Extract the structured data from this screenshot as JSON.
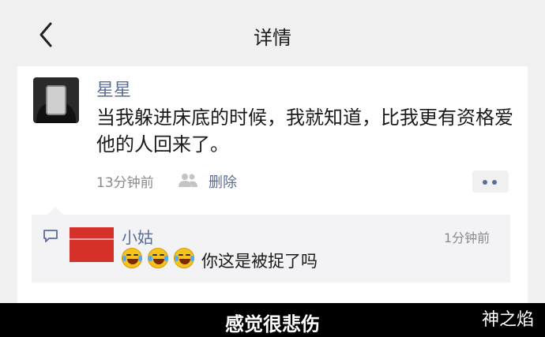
{
  "header": {
    "title": "详情",
    "back_icon": "chevron-left-icon"
  },
  "post": {
    "author": "星星",
    "content": "当我躲进床底的时候，我就知道，比我更有资格爱他的人回来了。",
    "time": "13分钟前",
    "delete_label": "删除",
    "likes_icon": "people-icon",
    "more_icon": "more-dots-icon"
  },
  "comment": {
    "icon": "comment-icon",
    "author": "小姑",
    "time": "1分钟前",
    "emoji_count": 3,
    "text": "你这是被捉了吗"
  },
  "caption": "感觉很悲伤",
  "watermark": "神之焰",
  "colors": {
    "link": "#5a6d96",
    "caption_bg": "#000000"
  }
}
